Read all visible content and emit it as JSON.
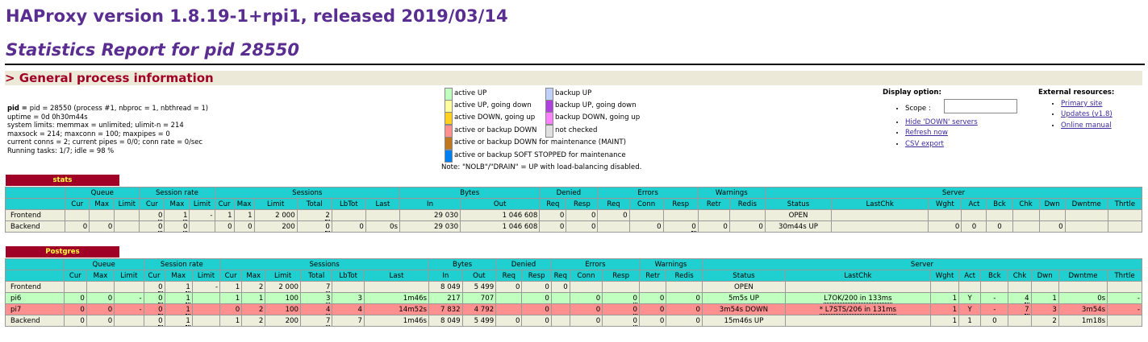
{
  "header": {
    "title": "HAProxy version 1.8.19-1+rpi1, released 2019/03/14",
    "subtitle": "Statistics Report for pid 28550"
  },
  "general": {
    "section_title": "> General process information",
    "lines": [
      "pid = 28550 (process #1, nbproc = 1, nbthread = 1)",
      "uptime = 0d 0h30m44s",
      "system limits: memmax = unlimited; ulimit-n = 214",
      "maxsock = 214; maxconn = 100; maxpipes = 0",
      "current conns = 2; current pipes = 0/0; conn rate = 0/sec",
      "Running tasks: 1/7; idle = 98 %"
    ]
  },
  "legend": {
    "items": [
      {
        "label": "active UP",
        "color": "#c0ffc0"
      },
      {
        "label": "active UP, going down",
        "color": "#ffffa0"
      },
      {
        "label": "active DOWN, going up",
        "color": "#ffd020"
      },
      {
        "label": "active or backup DOWN",
        "color": "#ff9090"
      },
      {
        "label": "active or backup DOWN for maintenance (MAINT)",
        "color": "#c07820"
      },
      {
        "label": "active or backup SOFT STOPPED for maintenance",
        "color": "#0080f0"
      },
      {
        "label": "backup UP",
        "color": "#c0d0ff"
      },
      {
        "label": "backup UP, going down",
        "color": "#b040e0"
      },
      {
        "label": "backup DOWN, going up",
        "color": "#ff80ff"
      },
      {
        "label": "not checked",
        "color": "#e0e0e0"
      }
    ],
    "note": "Note: \"NOLB\"/\"DRAIN\" = UP with load-balancing disabled."
  },
  "display": {
    "title": "Display option:",
    "scope_label": "Scope :",
    "hide_down": "Hide 'DOWN' servers",
    "refresh": "Refresh now",
    "csv": "CSV export"
  },
  "external": {
    "title": "External resources:",
    "primary": "Primary site",
    "updates": "Updates (v1.8)",
    "manual": "Online manual"
  },
  "headers": {
    "groups": [
      "Queue",
      "Session rate",
      "Sessions",
      "Bytes",
      "Denied",
      "Errors",
      "Warnings",
      "Server"
    ],
    "cols": [
      "Cur",
      "Max",
      "Limit",
      "Cur",
      "Max",
      "Limit",
      "Cur",
      "Max",
      "Limit",
      "Total",
      "LbTot",
      "Last",
      "In",
      "Out",
      "Req",
      "Resp",
      "Req",
      "Conn",
      "Resp",
      "Retr",
      "Redis",
      "Status",
      "LastChk",
      "Wght",
      "Act",
      "Bck",
      "Chk",
      "Dwn",
      "Dwntme",
      "Thrtle"
    ]
  },
  "stats": {
    "name": "stats",
    "rows": [
      {
        "name": "Frontend",
        "cells": [
          "",
          "",
          "",
          "0",
          "1",
          "-",
          "1",
          "1",
          "2 000",
          "2",
          "",
          "",
          "29 030",
          "1 046 608",
          "0",
          "0",
          "0",
          "",
          "",
          "",
          "",
          "OPEN",
          "",
          "",
          "",
          "",
          "",
          "",
          "",
          ""
        ]
      },
      {
        "name": "Backend",
        "cells": [
          "0",
          "0",
          "",
          "0",
          "0",
          "",
          "0",
          "0",
          "200",
          "0",
          "0",
          "0s",
          "29 030",
          "1 046 608",
          "0",
          "0",
          "",
          "0",
          "0",
          "0",
          "0",
          "30m44s UP",
          "",
          "0",
          "0",
          "0",
          "",
          "0",
          "",
          ""
        ]
      }
    ]
  },
  "postgres": {
    "name": "Postgres",
    "rows": [
      {
        "name": "Frontend",
        "cells": [
          "",
          "",
          "",
          "0",
          "1",
          "-",
          "1",
          "2",
          "2 000",
          "7",
          "",
          "",
          "8 049",
          "5 499",
          "0",
          "0",
          "0",
          "",
          "",
          "",
          "",
          "OPEN",
          "",
          "",
          "",
          "",
          "",
          "",
          "",
          ""
        ]
      },
      {
        "name": "pi6",
        "cells": [
          "0",
          "0",
          "-",
          "0",
          "1",
          "",
          "1",
          "1",
          "100",
          "3",
          "3",
          "1m46s",
          "217",
          "707",
          "",
          "0",
          "",
          "0",
          "0",
          "0",
          "0",
          "5m5s UP",
          "L7OK/200 in 133ms",
          "1",
          "Y",
          "-",
          "4",
          "1",
          "0s",
          "-"
        ]
      },
      {
        "name": "pi7",
        "cells": [
          "0",
          "0",
          "-",
          "0",
          "1",
          "",
          "0",
          "2",
          "100",
          "4",
          "4",
          "14m52s",
          "7 832",
          "4 792",
          "",
          "0",
          "",
          "0",
          "0",
          "0",
          "0",
          "3m54s DOWN",
          "* L7STS/206 in 131ms",
          "1",
          "Y",
          "-",
          "7",
          "3",
          "3m54s",
          "-"
        ]
      },
      {
        "name": "Backend",
        "cells": [
          "0",
          "0",
          "",
          "0",
          "1",
          "",
          "1",
          "2",
          "200",
          "7",
          "7",
          "1m46s",
          "8 049",
          "5 499",
          "0",
          "0",
          "",
          "0",
          "0",
          "0",
          "0",
          "15m46s UP",
          "",
          "1",
          "1",
          "0",
          "",
          "2",
          "1m18s",
          ""
        ]
      }
    ]
  }
}
